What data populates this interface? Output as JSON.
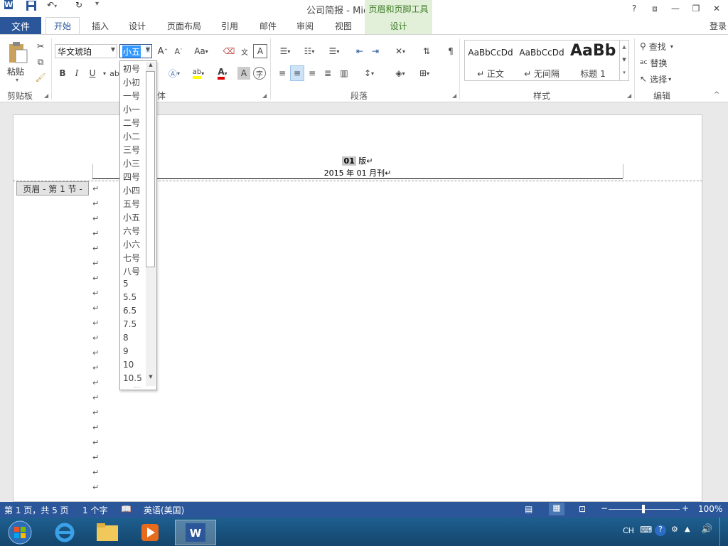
{
  "titlebar": {
    "title": "公司简报 - Microsoft Word",
    "context_title": "页眉和页脚工具",
    "help": "?",
    "min": "—",
    "restore": "❐",
    "close": "✕"
  },
  "tabs": {
    "file": "文件",
    "home": "开始",
    "insert": "插入",
    "design": "设计",
    "layout": "页面布局",
    "references": "引用",
    "mailings": "邮件",
    "review": "审阅",
    "view": "视图",
    "hf_design": "设计",
    "login": "登录"
  },
  "ribbon": {
    "clipboard": {
      "paste": "粘贴",
      "label": "剪贴板"
    },
    "font": {
      "name": "华文琥珀",
      "size": "小五",
      "bold": "B",
      "italic": "I",
      "underline": "U",
      "label": "字体",
      "label_visible": "体",
      "change_case": "Aa",
      "grow": "A",
      "shrink": "A",
      "char_border": "A"
    },
    "paragraph": {
      "label": "段落"
    },
    "styles": {
      "label": "样式",
      "items": [
        {
          "preview": "AaBbCcDd",
          "name": "↵ 正文"
        },
        {
          "preview": "AaBbCcDd",
          "name": "↵ 无间隔"
        },
        {
          "preview": "AaBb",
          "name": "标题 1"
        }
      ]
    },
    "editing": {
      "find": "查找",
      "replace": "替换",
      "select": "选择",
      "label": "编辑"
    }
  },
  "font_size_dropdown": {
    "items": [
      "初号",
      "小初",
      "一号",
      "小一",
      "二号",
      "小二",
      "三号",
      "小三",
      "四号",
      "小四",
      "五号",
      "小五",
      "六号",
      "小六",
      "七号",
      "八号",
      "5",
      "5.5",
      "6.5",
      "7.5",
      "8",
      "9",
      "10",
      "10.5"
    ],
    "selected": "小五"
  },
  "document": {
    "header_line1_num": "01",
    "header_line1_rest": "版↵",
    "header_line2": "2015 年 01 月刊↵",
    "header_label": "页眉 - 第 1 节 -",
    "para_mark": "↵"
  },
  "status": {
    "page": "第 1 页，共 5 页",
    "words": "1 个字",
    "language": "英语(美国)",
    "zoom": "100%"
  },
  "taskbar": {
    "ime": "CH"
  },
  "colors": {
    "accent": "#2b579a",
    "context_tab": "#e2efd9",
    "context_text": "#3f7f2a"
  }
}
